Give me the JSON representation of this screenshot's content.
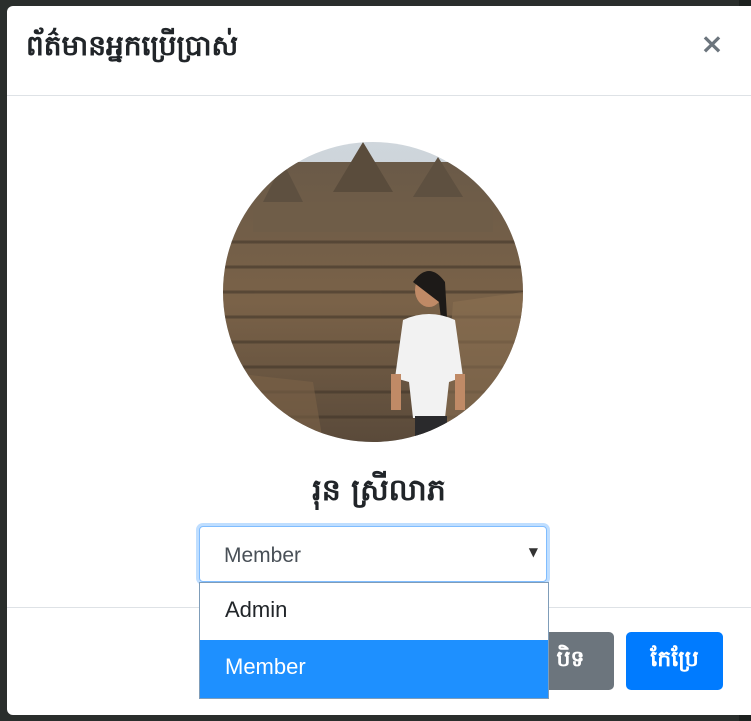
{
  "modal": {
    "title": "ព័ត៌មានអ្នកប្រើប្រាស់",
    "close_label": "×"
  },
  "user": {
    "name": "រុន ស្រីលាភ"
  },
  "role_select": {
    "selected": "Member",
    "options": [
      "Admin",
      "Member"
    ],
    "highlighted_option": "Member"
  },
  "footer": {
    "close_button_label": "បិទ",
    "edit_button_label": "កែប្រែ"
  },
  "colors": {
    "primary": "#007bff",
    "secondary": "#6c757d",
    "option_highlight": "#1e90ff"
  },
  "icons": {
    "close": "close-icon",
    "dropdown": "chevron-down-icon"
  }
}
